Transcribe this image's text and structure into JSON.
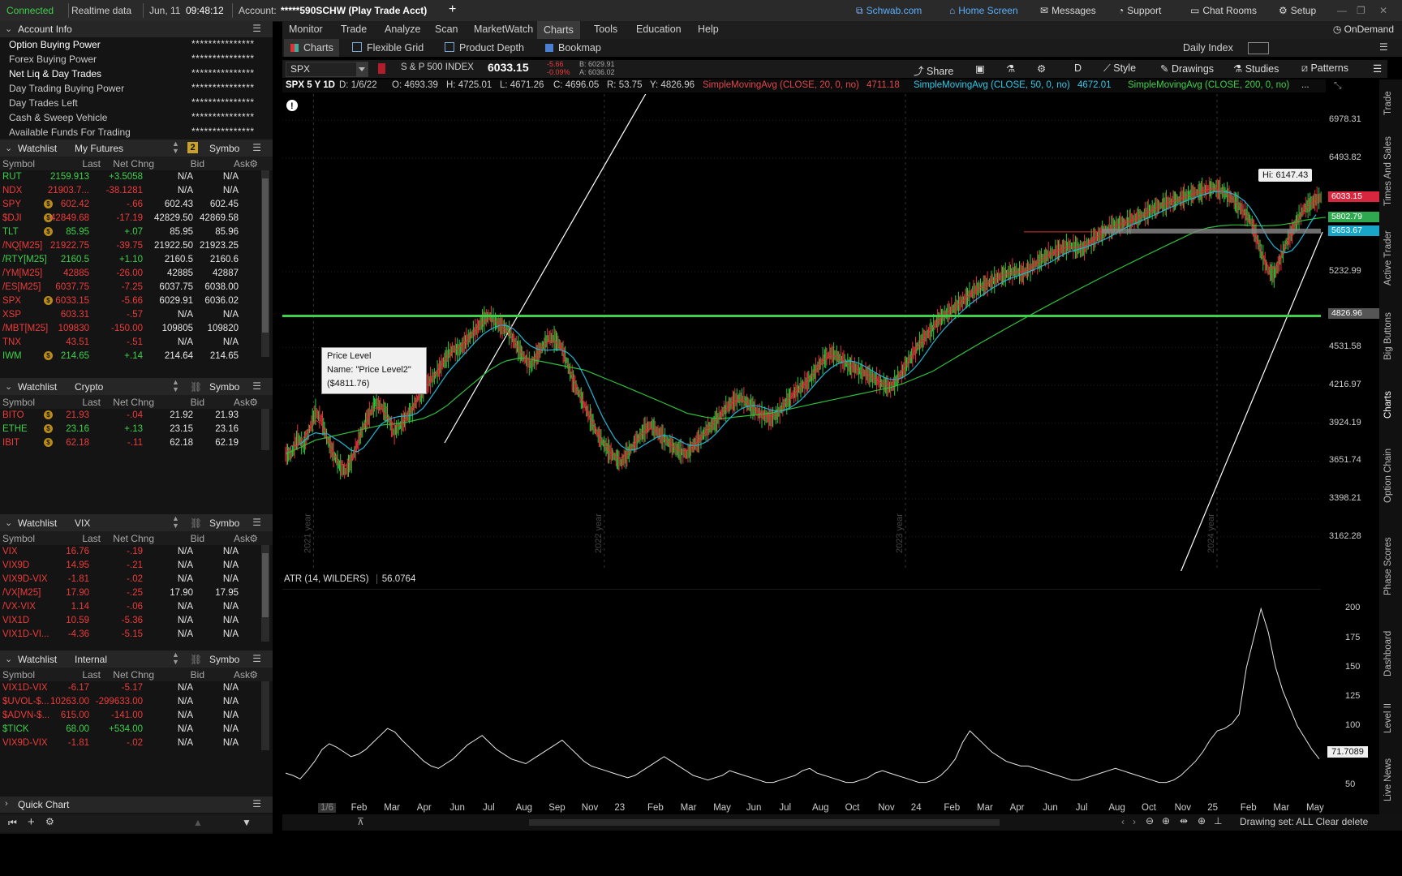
{
  "status": {
    "connection": "Connected",
    "data_mode": "Realtime data",
    "date": "Jun, 11",
    "time": "09:48:12",
    "account_label": "Account:",
    "account_value": "*****590SCHW (Play Trade Acct)",
    "add": "+"
  },
  "top_links": {
    "schwab": "Schwab.com",
    "home": "Home Screen",
    "messages": "Messages",
    "support": "Support",
    "chat": "Chat Rooms",
    "setup": "Setup"
  },
  "account_info": {
    "title": "Account Info",
    "rows": [
      {
        "label": "Option Buying Power",
        "value": "***************"
      },
      {
        "label": "Forex Buying Power",
        "value": "***************"
      },
      {
        "label": "Net Liq & Day Trades",
        "value": "***************"
      },
      {
        "label": "Day Trading Buying Power",
        "value": "***************"
      },
      {
        "label": "Day Trades Left",
        "value": "***************"
      },
      {
        "label": "Cash & Sweep Vehicle",
        "value": "***************"
      },
      {
        "label": "Available Funds For Trading",
        "value": "***************"
      }
    ]
  },
  "watchlists": [
    {
      "title": "Watchlist",
      "name": "My Futures",
      "badge": "2",
      "symbo": "Symbo",
      "cols": [
        "Symbol",
        "Last",
        "Net Chng",
        "Bid",
        "Ask"
      ],
      "rows": [
        {
          "sym": "RUT",
          "dot": false,
          "last": "2159.913",
          "chg": "+3.5058",
          "bid": "N/A",
          "ask": "N/A",
          "dir": "up"
        },
        {
          "sym": "NDX",
          "dot": false,
          "last": "21903.7...",
          "chg": "-38.1281",
          "bid": "N/A",
          "ask": "N/A",
          "dir": "dn"
        },
        {
          "sym": "SPY",
          "dot": true,
          "last": "602.42",
          "chg": "-.66",
          "bid": "602.43",
          "ask": "602.45",
          "dir": "dn"
        },
        {
          "sym": "$DJI",
          "dot": true,
          "last": "42849.68",
          "chg": "-17.19",
          "bid": "42829.50",
          "ask": "42869.58",
          "dir": "dn"
        },
        {
          "sym": "TLT",
          "dot": true,
          "last": "85.95",
          "chg": "+.07",
          "bid": "85.95",
          "ask": "85.96",
          "dir": "up"
        },
        {
          "sym": "/NQ[M25]",
          "dot": false,
          "last": "21922.75",
          "chg": "-39.75",
          "bid": "21922.50",
          "ask": "21923.25",
          "dir": "dn"
        },
        {
          "sym": "/RTY[M25]",
          "dot": false,
          "last": "2160.5",
          "chg": "+1.10",
          "bid": "2160.5",
          "ask": "2160.6",
          "dir": "up"
        },
        {
          "sym": "/YM[M25]",
          "dot": false,
          "last": "42885",
          "chg": "-26.00",
          "bid": "42885",
          "ask": "42887",
          "dir": "dn"
        },
        {
          "sym": "/ES[M25]",
          "dot": false,
          "last": "6037.75",
          "chg": "-7.25",
          "bid": "6037.75",
          "ask": "6038.00",
          "dir": "dn"
        },
        {
          "sym": "SPX",
          "dot": true,
          "last": "6033.15",
          "chg": "-5.66",
          "bid": "6029.91",
          "ask": "6036.02",
          "dir": "dn"
        },
        {
          "sym": "XSP",
          "dot": false,
          "last": "603.31",
          "chg": "-.57",
          "bid": "N/A",
          "ask": "N/A",
          "dir": "dn"
        },
        {
          "sym": "/MBT[M25]",
          "dot": false,
          "last": "109830",
          "chg": "-150.00",
          "bid": "109805",
          "ask": "109820",
          "dir": "dn"
        },
        {
          "sym": "TNX",
          "dot": false,
          "last": "43.51",
          "chg": "-.51",
          "bid": "N/A",
          "ask": "N/A",
          "dir": "dn"
        },
        {
          "sym": "IWM",
          "dot": true,
          "last": "214.65",
          "chg": "+.14",
          "bid": "214.64",
          "ask": "214.65",
          "dir": "up"
        }
      ]
    },
    {
      "title": "Watchlist",
      "name": "Crypto",
      "symbo": "Symbo",
      "cols": [
        "Symbol",
        "Last",
        "Net Chng",
        "Bid",
        "Ask"
      ],
      "rows": [
        {
          "sym": "BITO",
          "dot": true,
          "last": "21.93",
          "chg": "-.04",
          "bid": "21.92",
          "ask": "21.93",
          "dir": "dn"
        },
        {
          "sym": "ETHE",
          "dot": true,
          "last": "23.16",
          "chg": "+.13",
          "bid": "23.15",
          "ask": "23.16",
          "dir": "up"
        },
        {
          "sym": "IBIT",
          "dot": true,
          "last": "62.18",
          "chg": "-.11",
          "bid": "62.18",
          "ask": "62.19",
          "dir": "dn"
        }
      ]
    },
    {
      "title": "Watchlist",
      "name": "VIX",
      "symbo": "Symbo",
      "cols": [
        "Symbol",
        "Last",
        "Net Chng",
        "Bid",
        "Ask"
      ],
      "rows": [
        {
          "sym": "VIX",
          "dot": false,
          "last": "16.76",
          "chg": "-.19",
          "bid": "N/A",
          "ask": "N/A",
          "dir": "dn"
        },
        {
          "sym": "VIX9D",
          "dot": false,
          "last": "14.95",
          "chg": "-.21",
          "bid": "N/A",
          "ask": "N/A",
          "dir": "dn"
        },
        {
          "sym": "VIX9D-VIX",
          "dot": false,
          "last": "-1.81",
          "chg": "-.02",
          "bid": "N/A",
          "ask": "N/A",
          "dir": "dn"
        },
        {
          "sym": "/VX[M25]",
          "dot": false,
          "last": "17.90",
          "chg": "-.25",
          "bid": "17.90",
          "ask": "17.95",
          "dir": "dn"
        },
        {
          "sym": "/VX-VIX",
          "dot": false,
          "last": "1.14",
          "chg": "-.06",
          "bid": "N/A",
          "ask": "N/A",
          "dir": "dn"
        },
        {
          "sym": "VIX1D",
          "dot": false,
          "last": "10.59",
          "chg": "-5.36",
          "bid": "N/A",
          "ask": "N/A",
          "dir": "dn"
        },
        {
          "sym": "VIX1D-VI...",
          "dot": false,
          "last": "-4.36",
          "chg": "-5.15",
          "bid": "N/A",
          "ask": "N/A",
          "dir": "dn"
        }
      ]
    },
    {
      "title": "Watchlist",
      "name": "Internal",
      "symbo": "Symbo",
      "cols": [
        "Symbol",
        "Last",
        "Net Chng",
        "Bid",
        "Ask"
      ],
      "rows": [
        {
          "sym": "VIX1D-VIX",
          "dot": false,
          "last": "-6.17",
          "chg": "-5.17",
          "bid": "N/A",
          "ask": "N/A",
          "dir": "dn"
        },
        {
          "sym": "$UVOL-$...",
          "dot": false,
          "last": "10263.00",
          "chg": "-299633.00",
          "bid": "N/A",
          "ask": "N/A",
          "dir": "dn"
        },
        {
          "sym": "$ADVN-$...",
          "dot": false,
          "last": "615.00",
          "chg": "-141.00",
          "bid": "N/A",
          "ask": "N/A",
          "dir": "dn"
        },
        {
          "sym": "$TICK",
          "dot": false,
          "last": "68.00",
          "chg": "+534.00",
          "bid": "N/A",
          "ask": "N/A",
          "dir": "up"
        },
        {
          "sym": "VIX9D-VIX",
          "dot": false,
          "last": "-1.81",
          "chg": "-.02",
          "bid": "N/A",
          "ask": "N/A",
          "dir": "dn"
        }
      ]
    }
  ],
  "quick_chart": "Quick Chart",
  "menu": {
    "items": [
      "Monitor",
      "Trade",
      "Analyze",
      "Scan",
      "MarketWatch",
      "Charts",
      "Tools",
      "Education",
      "Help"
    ],
    "active": "Charts",
    "ondemand": "OnDemand"
  },
  "subtabs": {
    "items": [
      "Charts",
      "Flexible Grid",
      "Product Depth",
      "Bookmap"
    ],
    "daily_index": "Daily Index"
  },
  "symbol_bar": {
    "symbol": "SPX",
    "description": "S & P 500 INDEX",
    "price": "6033.15",
    "change": "-5.66",
    "change_pct": "-0.09%",
    "bid": "B: 6029.91",
    "ask": "A: 6036.02",
    "tools": {
      "share": "Share",
      "period": "D",
      "style": "Style",
      "drawings": "Drawings",
      "studies": "Studies",
      "patterns": "Patterns"
    }
  },
  "info_line": {
    "instrument": "SPX 5 Y 1D",
    "date": "D: 1/6/22",
    "open": "O: 4693.39",
    "high": "H: 4725.01",
    "low": "L: 4671.26",
    "close": "C: 4696.05",
    "range": "R: 53.75",
    "y": "Y: 4826.96",
    "sma20": "SimpleMovingAvg (CLOSE, 20, 0, no)",
    "sma20_val": "4711.18",
    "sma50": "SimpleMovingAvg (CLOSE, 50, 0, no)",
    "sma50_val": "4672.01",
    "sma200": "SimpleMovingAvg (CLOSE, 200, 0, no)",
    "more": "..."
  },
  "tooltip": {
    "title": "Price Level",
    "name": "Name: \"Price Level2\"",
    "value": "($4811.76)"
  },
  "chart_data": {
    "type": "line",
    "title": "SPX 5 Y 1D",
    "y_ticks": [
      "6978.31",
      "6493.82",
      "5232.99",
      "4531.58",
      "4216.97",
      "3924.19",
      "3651.74",
      "3398.21",
      "3162.28"
    ],
    "ylim": [
      3000,
      7200
    ],
    "year_labels": [
      "2021 year",
      "2022 year",
      "2023 year",
      "2024 year"
    ],
    "x_ticks": [
      "1/6",
      "Feb",
      "Mar",
      "Apr",
      "Jun",
      "Jul",
      "Aug",
      "Sep",
      "Nov",
      "23",
      "Feb",
      "Mar",
      "May",
      "Jun",
      "Jul",
      "Aug",
      "Oct",
      "Nov",
      "24",
      "Feb",
      "Mar",
      "Apr",
      "Jun",
      "Jul",
      "Aug",
      "Oct",
      "Nov",
      "25",
      "Feb",
      "Mar",
      "May"
    ],
    "price_tags": [
      {
        "label": "6033.15",
        "color": "#d7263d",
        "value": 6033.15
      },
      {
        "label": "5802.79",
        "color": "#2fa84f",
        "value": 5802.79
      },
      {
        "label": "5653.67",
        "color": "#17a6c7",
        "value": 5653.67
      },
      {
        "label": "4826.96",
        "color": "#555555",
        "value": 4826.96
      }
    ],
    "hi_label": "Hi: 6147.43",
    "horizontal_level": 4811.76,
    "series_close": [
      3700,
      3820,
      3760,
      3880,
      4010,
      3950,
      3800,
      3700,
      3620,
      3580,
      3660,
      3770,
      3900,
      3990,
      4080,
      4050,
      3980,
      3860,
      3900,
      3960,
      4020,
      4110,
      4180,
      4250,
      4300,
      4380,
      4460,
      4520,
      4510,
      4580,
      4640,
      4700,
      4780,
      4810,
      4760,
      4720,
      4690,
      4600,
      4510,
      4430,
      4380,
      4470,
      4550,
      4620,
      4600,
      4540,
      4400,
      4250,
      4150,
      4050,
      3950,
      3850,
      3780,
      3720,
      3680,
      3640,
      3700,
      3760,
      3820,
      3880,
      3910,
      3860,
      3820,
      3780,
      3740,
      3720,
      3700,
      3760,
      3800,
      3860,
      3900,
      3950,
      4010,
      4060,
      4100,
      4120,
      4080,
      4040,
      4000,
      3980,
      3960,
      3990,
      4050,
      4110,
      4160,
      4200,
      4240,
      4300,
      4380,
      4440,
      4480,
      4460,
      4420,
      4380,
      4360,
      4330,
      4310,
      4280,
      4250,
      4220,
      4200,
      4260,
      4330,
      4420,
      4500,
      4580,
      4640,
      4700,
      4780,
      4820,
      4860,
      4900,
      4950,
      5000,
      5050,
      5080,
      5110,
      5140,
      5180,
      5200,
      5230,
      5240,
      5210,
      5260,
      5300,
      5350,
      5390,
      5420,
      5450,
      5480,
      5500,
      5480,
      5460,
      5520,
      5570,
      5620,
      5660,
      5700,
      5720,
      5740,
      5760,
      5790,
      5820,
      5860,
      5900,
      5930,
      5960,
      5980,
      6000,
      6030,
      6060,
      6080,
      6100,
      6120,
      6140,
      6110,
      6070,
      6020,
      5940,
      5860,
      5780,
      5600,
      5400,
      5250,
      5200,
      5350,
      5520,
      5650,
      5780,
      5900,
      5950,
      6000,
      6033
    ],
    "series_sma200": [
      3700,
      3720,
      3740,
      3760,
      3780,
      3800,
      3810,
      3820,
      3830,
      3840,
      3850,
      3860,
      3870,
      3880,
      3890,
      3900,
      3910,
      3915,
      3920,
      3925,
      3930,
      3940,
      3950,
      3960,
      3980,
      4000,
      4030,
      4060,
      4100,
      4140,
      4180,
      4220,
      4260,
      4300,
      4340,
      4370,
      4400,
      4420,
      4430,
      4440,
      4440,
      4430,
      4420,
      4410,
      4400,
      4390,
      4380,
      4370,
      4360,
      4350,
      4340,
      4320,
      4300,
      4280,
      4260,
      4240,
      4220,
      4200,
      4180,
      4160,
      4140,
      4120,
      4100,
      4080,
      4060,
      4040,
      4020,
      4000,
      3990,
      3980,
      3970,
      3965,
      3960,
      3960,
      3965,
      3970,
      3975,
      3980,
      3985,
      3990,
      3995,
      4000,
      4010,
      4020,
      4030,
      4040,
      4050,
      4060,
      4070,
      4080,
      4090,
      4100,
      4110,
      4120,
      4130,
      4140,
      4150,
      4160,
      4170,
      4180,
      4190,
      4200,
      4215,
      4230,
      4250,
      4270,
      4290,
      4310,
      4330,
      4360,
      4390,
      4420,
      4450,
      4480,
      4510,
      4540,
      4570,
      4600,
      4630,
      4660,
      4690,
      4720,
      4750,
      4780,
      4810,
      4840,
      4870,
      4900,
      4930,
      4960,
      4990,
      5020,
      5050,
      5080,
      5110,
      5140,
      5170,
      5200,
      5230,
      5260,
      5290,
      5320,
      5350,
      5380,
      5410,
      5440,
      5470,
      5500,
      5530,
      5560,
      5590,
      5620,
      5650,
      5670,
      5690,
      5700,
      5710,
      5715,
      5720,
      5720,
      5718,
      5715,
      5712,
      5710,
      5712,
      5715,
      5720,
      5730,
      5740,
      5755,
      5770,
      5780,
      5790,
      5800,
      5803
    ],
    "atr_label": "ATR (14, WILDERS)",
    "atr_value": "56.0764",
    "atr_last_tag": "71.7089",
    "atr_y_ticks": [
      "200",
      "175",
      "150",
      "125",
      "100",
      "50"
    ],
    "atr_ylim": [
      40,
      210
    ],
    "atr_series": [
      60,
      58,
      55,
      62,
      70,
      80,
      85,
      82,
      78,
      74,
      76,
      80,
      86,
      92,
      98,
      95,
      88,
      82,
      76,
      70,
      66,
      64,
      68,
      72,
      78,
      84,
      88,
      92,
      86,
      80,
      76,
      72,
      70,
      68,
      72,
      76,
      80,
      84,
      88,
      82,
      76,
      70,
      66,
      64,
      62,
      60,
      58,
      56,
      58,
      62,
      66,
      70,
      74,
      70,
      66,
      62,
      58,
      56,
      54,
      56,
      58,
      62,
      60,
      58,
      56,
      54,
      52,
      52,
      54,
      56,
      58,
      62,
      64,
      60,
      58,
      56,
      54,
      52,
      52,
      54,
      56,
      60,
      62,
      60,
      58,
      56,
      54,
      52,
      52,
      54,
      58,
      64,
      72,
      86,
      96,
      90,
      84,
      78,
      74,
      70,
      68,
      66,
      66,
      64,
      62,
      60,
      58,
      56,
      54,
      54,
      56,
      58,
      60,
      62,
      64,
      62,
      60,
      58,
      56,
      54,
      52,
      52,
      54,
      58,
      64,
      70,
      78,
      88,
      96,
      98,
      102,
      110,
      150,
      175,
      200,
      180,
      150,
      130,
      115,
      100,
      90,
      80,
      72
    ]
  },
  "bottom_tools": {
    "status": "Drawing set: ALL Clear delete"
  },
  "right_tabs": [
    "Trade",
    "Times And Sales",
    "Active Trader",
    "Big Buttons",
    "Charts",
    "Option Chain",
    "Phase Scores",
    "Dashboard",
    "Level II",
    "Live News"
  ]
}
